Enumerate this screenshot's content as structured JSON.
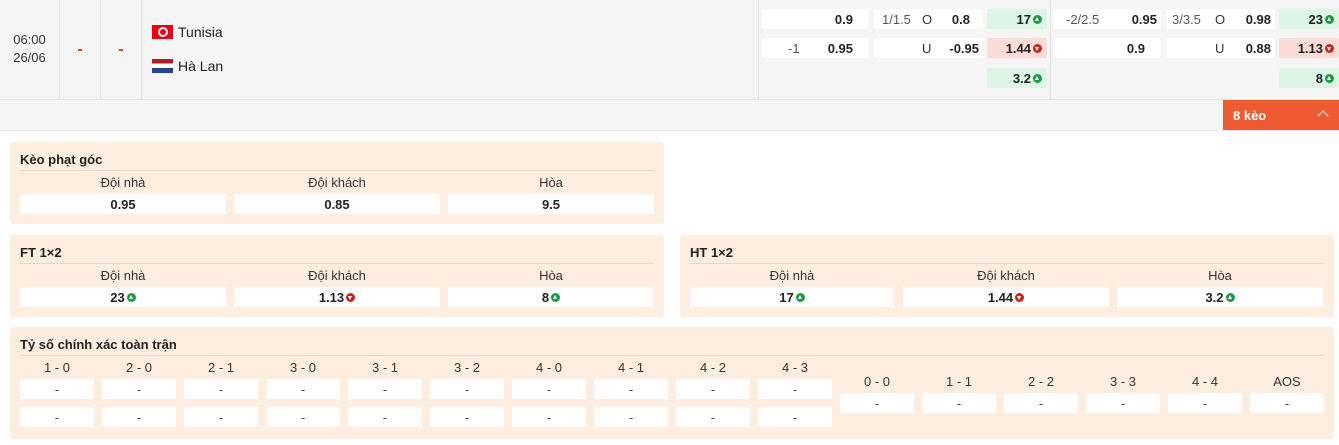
{
  "match": {
    "time": "06:00",
    "date": "26/06",
    "score_home": "-",
    "score_away": "-",
    "home_team": "Tunisia",
    "away_team": "Hà Lan",
    "home_flag": "tunisia-flag",
    "away_flag": "netherlands-flag"
  },
  "odds_ft": {
    "row1": {
      "ah_line": "",
      "ah_val": "0.9",
      "ou_line": "1/1.5",
      "ou_side": "O",
      "ou_val": "0.8",
      "x12": "17",
      "x12_dir": "up"
    },
    "row2": {
      "ah_line": "-1",
      "ah_val": "0.95",
      "ou_line": "",
      "ou_side": "U",
      "ou_val": "-0.95",
      "x12": "1.44",
      "x12_dir": "down"
    },
    "row3": {
      "x12": "3.2",
      "x12_dir": "up"
    }
  },
  "odds_ht": {
    "row1": {
      "ah_line": "-2/2.5",
      "ah_val": "0.95",
      "ou_line": "3/3.5",
      "ou_side": "O",
      "ou_val": "0.98",
      "x12": "23",
      "x12_dir": "up"
    },
    "row2": {
      "ah_line": "",
      "ah_val": "0.9",
      "ou_line": "",
      "ou_side": "U",
      "ou_val": "0.88",
      "x12": "1.13",
      "x12_dir": "down"
    },
    "row3": {
      "x12": "8",
      "x12_dir": "up"
    }
  },
  "more_odds_label": "8 kèo",
  "corner": {
    "title": "Kèo phạt góc",
    "headers": [
      "Đội nhà",
      "Đội khách",
      "Hòa"
    ],
    "values": [
      "0.95",
      "0.85",
      "9.5"
    ]
  },
  "ft12": {
    "title": "FT 1×2",
    "headers": [
      "Đội nhà",
      "Đội khách",
      "Hòa"
    ],
    "values": [
      "23",
      "1.13",
      "8"
    ],
    "dirs": [
      "up",
      "down",
      "up"
    ]
  },
  "ht12": {
    "title": "HT 1×2",
    "headers": [
      "Đội nhà",
      "Đội khách",
      "Hòa"
    ],
    "values": [
      "17",
      "1.44",
      "3.2"
    ],
    "dirs": [
      "up",
      "down",
      "up"
    ]
  },
  "correct_score": {
    "title": "Tỷ số chính xác toàn trận",
    "left_headers": [
      "1 - 0",
      "2 - 0",
      "2 - 1",
      "3 - 0",
      "3 - 1",
      "3 - 2",
      "4 - 0",
      "4 - 1",
      "4 - 2",
      "4 - 3"
    ],
    "right_headers": [
      "0 - 0",
      "1 - 1",
      "2 - 2",
      "3 - 3",
      "4 - 4",
      "AOS"
    ],
    "empty": "-"
  },
  "colors": {
    "accent": "#ee5b33",
    "panel": "#fdeee0",
    "green": "#dcf5e4",
    "red": "#fbdcd7",
    "up": "#1c9a47",
    "down": "#c5281c"
  }
}
